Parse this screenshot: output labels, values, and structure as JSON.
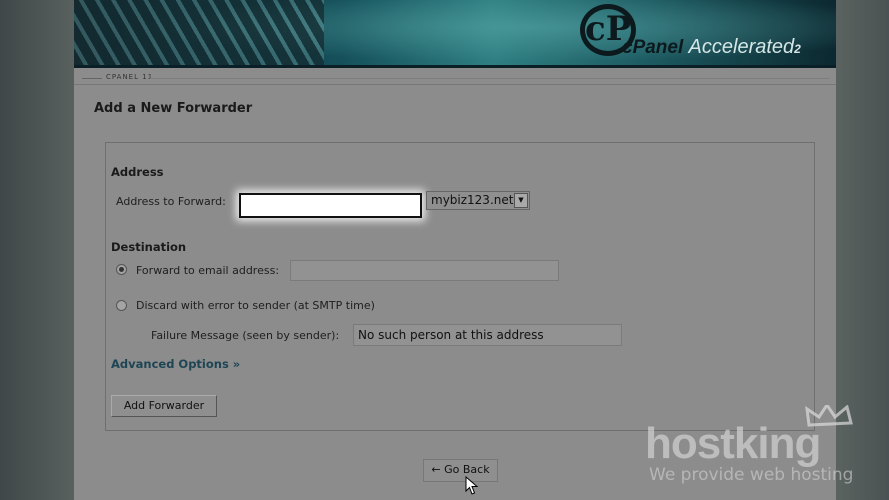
{
  "header": {
    "logo_mark": "cP",
    "brand": "cPanel",
    "brand_accent": "Accelerated",
    "brand_version": "2",
    "breadcrumb": "CPANEL 11"
  },
  "page": {
    "title": "Add a New Forwarder"
  },
  "address": {
    "heading": "Address",
    "forward_label": "Address to Forward:",
    "forward_value": "",
    "domain_selected": "mybiz123.net"
  },
  "destination": {
    "heading": "Destination",
    "forward_email_label": "Forward to email address:",
    "forward_email_value": "",
    "discard_label": "Discard with error to sender (at SMTP time)",
    "failure_label": "Failure Message (seen by sender):",
    "failure_value": "No such person at this address",
    "selected_option": "forward"
  },
  "advanced_link": "Advanced Options »",
  "buttons": {
    "add_forwarder": "Add Forwarder",
    "go_back": "← Go Back"
  },
  "watermark": {
    "brand": "hostking",
    "tagline": "We provide web hosting"
  },
  "colors": {
    "page_bg": "#8c8c8c",
    "banner_teal": "#2f7f82",
    "link": "#1d4554"
  }
}
